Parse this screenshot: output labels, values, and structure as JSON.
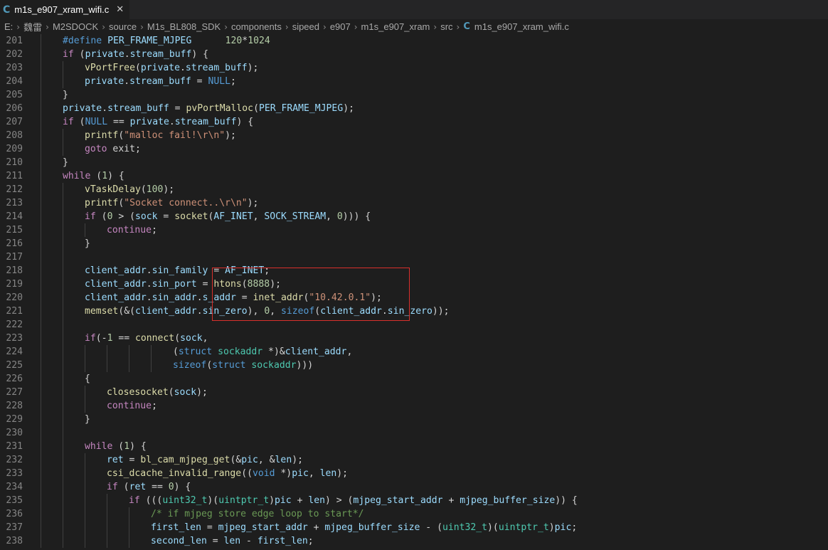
{
  "tab": {
    "icon": "C",
    "label": "m1s_e907_xram_wifi.c",
    "close": "✕"
  },
  "breadcrumb": {
    "items": [
      "E:",
      "魏雷",
      "M2SDOCK",
      "source",
      "M1s_BL808_SDK",
      "components",
      "sipeed",
      "e907",
      "m1s_e907_xram",
      "src"
    ],
    "file_icon": "C",
    "file": "m1s_e907_xram_wifi.c"
  },
  "colors": {
    "background": "#1e1e1e",
    "highlight_box": "#d9302c",
    "keyword": "#569cd6",
    "control": "#c586c0",
    "function": "#dcdcaa",
    "string": "#ce9178",
    "number": "#b5cea8",
    "comment": "#6a9955"
  },
  "lines": [
    {
      "n": "201",
      "indent": 1,
      "tokens": [
        [
          "macro",
          "#define "
        ],
        [
          "var",
          "PER_FRAME_MJPEG"
        ],
        [
          "pl",
          "      "
        ],
        [
          "num",
          "120"
        ],
        [
          "pl",
          "*"
        ],
        [
          "num",
          "1024"
        ]
      ]
    },
    {
      "n": "202",
      "indent": 1,
      "tokens": [
        [
          "ctl",
          "if"
        ],
        [
          "pl",
          " ("
        ],
        [
          "var",
          "private"
        ],
        [
          "pl",
          "."
        ],
        [
          "var",
          "stream_buff"
        ],
        [
          "pl",
          ") {"
        ]
      ]
    },
    {
      "n": "203",
      "indent": 2,
      "tokens": [
        [
          "fn",
          "vPortFree"
        ],
        [
          "pl",
          "("
        ],
        [
          "var",
          "private"
        ],
        [
          "pl",
          "."
        ],
        [
          "var",
          "stream_buff"
        ],
        [
          "pl",
          ");"
        ]
      ]
    },
    {
      "n": "204",
      "indent": 2,
      "tokens": [
        [
          "var",
          "private"
        ],
        [
          "pl",
          "."
        ],
        [
          "var",
          "stream_buff"
        ],
        [
          "pl",
          " = "
        ],
        [
          "kw",
          "NULL"
        ],
        [
          "pl",
          ";"
        ]
      ]
    },
    {
      "n": "205",
      "indent": 1,
      "tokens": [
        [
          "pl",
          "}"
        ]
      ]
    },
    {
      "n": "206",
      "indent": 1,
      "tokens": [
        [
          "var",
          "private"
        ],
        [
          "pl",
          "."
        ],
        [
          "var",
          "stream_buff"
        ],
        [
          "pl",
          " = "
        ],
        [
          "fn",
          "pvPortMalloc"
        ],
        [
          "pl",
          "("
        ],
        [
          "var",
          "PER_FRAME_MJPEG"
        ],
        [
          "pl",
          ");"
        ]
      ]
    },
    {
      "n": "207",
      "indent": 1,
      "tokens": [
        [
          "ctl",
          "if"
        ],
        [
          "pl",
          " ("
        ],
        [
          "kw",
          "NULL"
        ],
        [
          "pl",
          " == "
        ],
        [
          "var",
          "private"
        ],
        [
          "pl",
          "."
        ],
        [
          "var",
          "stream_buff"
        ],
        [
          "pl",
          ") {"
        ]
      ]
    },
    {
      "n": "208",
      "indent": 2,
      "tokens": [
        [
          "fn",
          "printf"
        ],
        [
          "pl",
          "("
        ],
        [
          "str",
          "\"malloc fail!\\r\\n\""
        ],
        [
          "pl",
          ");"
        ]
      ]
    },
    {
      "n": "209",
      "indent": 2,
      "tokens": [
        [
          "ctl",
          "goto"
        ],
        [
          "pl",
          " exit;"
        ]
      ]
    },
    {
      "n": "210",
      "indent": 1,
      "tokens": [
        [
          "pl",
          "}"
        ]
      ]
    },
    {
      "n": "211",
      "indent": 1,
      "tokens": [
        [
          "ctl",
          "while"
        ],
        [
          "pl",
          " ("
        ],
        [
          "num",
          "1"
        ],
        [
          "pl",
          ") {"
        ]
      ]
    },
    {
      "n": "212",
      "indent": 2,
      "tokens": [
        [
          "fn",
          "vTaskDelay"
        ],
        [
          "pl",
          "("
        ],
        [
          "num",
          "100"
        ],
        [
          "pl",
          ");"
        ]
      ]
    },
    {
      "n": "213",
      "indent": 2,
      "tokens": [
        [
          "fn",
          "printf"
        ],
        [
          "pl",
          "("
        ],
        [
          "str",
          "\"Socket connect..\\r\\n\""
        ],
        [
          "pl",
          ");"
        ]
      ]
    },
    {
      "n": "214",
      "indent": 2,
      "tokens": [
        [
          "ctl",
          "if"
        ],
        [
          "pl",
          " ("
        ],
        [
          "num",
          "0"
        ],
        [
          "pl",
          " > ("
        ],
        [
          "var",
          "sock"
        ],
        [
          "pl",
          " = "
        ],
        [
          "fn",
          "socket"
        ],
        [
          "pl",
          "("
        ],
        [
          "var",
          "AF_INET"
        ],
        [
          "pl",
          ", "
        ],
        [
          "var",
          "SOCK_STREAM"
        ],
        [
          "pl",
          ", "
        ],
        [
          "num",
          "0"
        ],
        [
          "pl",
          "))) {"
        ]
      ]
    },
    {
      "n": "215",
      "indent": 3,
      "tokens": [
        [
          "ctl",
          "continue"
        ],
        [
          "pl",
          ";"
        ]
      ]
    },
    {
      "n": "216",
      "indent": 2,
      "tokens": [
        [
          "pl",
          "}"
        ]
      ]
    },
    {
      "n": "217",
      "indent": 2,
      "tokens": []
    },
    {
      "n": "218",
      "indent": 2,
      "tokens": [
        [
          "var",
          "client_addr"
        ],
        [
          "pl",
          "."
        ],
        [
          "var",
          "sin_family"
        ],
        [
          "pl",
          " = "
        ],
        [
          "var",
          "AF_INET"
        ],
        [
          "pl",
          ";"
        ]
      ]
    },
    {
      "n": "219",
      "indent": 2,
      "tokens": [
        [
          "var",
          "client_addr"
        ],
        [
          "pl",
          "."
        ],
        [
          "var",
          "sin_port"
        ],
        [
          "pl",
          " = "
        ],
        [
          "fn",
          "htons"
        ],
        [
          "pl",
          "("
        ],
        [
          "num",
          "8888"
        ],
        [
          "pl",
          ");"
        ]
      ]
    },
    {
      "n": "220",
      "indent": 2,
      "tokens": [
        [
          "var",
          "client_addr"
        ],
        [
          "pl",
          "."
        ],
        [
          "var",
          "sin_addr"
        ],
        [
          "pl",
          "."
        ],
        [
          "var",
          "s_addr"
        ],
        [
          "pl",
          " = "
        ],
        [
          "fn",
          "inet_addr"
        ],
        [
          "pl",
          "("
        ],
        [
          "str",
          "\"10.42.0.1\""
        ],
        [
          "pl",
          ");"
        ]
      ]
    },
    {
      "n": "221",
      "indent": 2,
      "tokens": [
        [
          "fn",
          "memset"
        ],
        [
          "pl",
          "(&("
        ],
        [
          "var",
          "client_addr"
        ],
        [
          "pl",
          "."
        ],
        [
          "var",
          "sin_zero"
        ],
        [
          "pl",
          "), "
        ],
        [
          "num",
          "0"
        ],
        [
          "pl",
          ", "
        ],
        [
          "kw",
          "sizeof"
        ],
        [
          "pl",
          "("
        ],
        [
          "var",
          "client_addr"
        ],
        [
          "pl",
          "."
        ],
        [
          "var",
          "sin_zero"
        ],
        [
          "pl",
          "));"
        ]
      ]
    },
    {
      "n": "222",
      "indent": 2,
      "tokens": []
    },
    {
      "n": "223",
      "indent": 2,
      "tokens": [
        [
          "ctl",
          "if"
        ],
        [
          "pl",
          "(-"
        ],
        [
          "num",
          "1"
        ],
        [
          "pl",
          " == "
        ],
        [
          "fn",
          "connect"
        ],
        [
          "pl",
          "("
        ],
        [
          "var",
          "sock"
        ],
        [
          "pl",
          ","
        ]
      ]
    },
    {
      "n": "224",
      "indent": 6,
      "tokens": [
        [
          "pl",
          "("
        ],
        [
          "kw",
          "struct"
        ],
        [
          "pl",
          " "
        ],
        [
          "type",
          "sockaddr"
        ],
        [
          "pl",
          " *)&"
        ],
        [
          "var",
          "client_addr"
        ],
        [
          "pl",
          ","
        ]
      ]
    },
    {
      "n": "225",
      "indent": 6,
      "tokens": [
        [
          "kw",
          "sizeof"
        ],
        [
          "pl",
          "("
        ],
        [
          "kw",
          "struct"
        ],
        [
          "pl",
          " "
        ],
        [
          "type",
          "sockaddr"
        ],
        [
          "pl",
          ")))"
        ]
      ]
    },
    {
      "n": "226",
      "indent": 2,
      "tokens": [
        [
          "pl",
          "{"
        ]
      ]
    },
    {
      "n": "227",
      "indent": 3,
      "tokens": [
        [
          "fn",
          "closesocket"
        ],
        [
          "pl",
          "("
        ],
        [
          "var",
          "sock"
        ],
        [
          "pl",
          ");"
        ]
      ]
    },
    {
      "n": "228",
      "indent": 3,
      "tokens": [
        [
          "ctl",
          "continue"
        ],
        [
          "pl",
          ";"
        ]
      ]
    },
    {
      "n": "229",
      "indent": 2,
      "tokens": [
        [
          "pl",
          "}"
        ]
      ]
    },
    {
      "n": "230",
      "indent": 2,
      "tokens": []
    },
    {
      "n": "231",
      "indent": 2,
      "tokens": [
        [
          "ctl",
          "while"
        ],
        [
          "pl",
          " ("
        ],
        [
          "num",
          "1"
        ],
        [
          "pl",
          ") {"
        ]
      ]
    },
    {
      "n": "232",
      "indent": 3,
      "tokens": [
        [
          "var",
          "ret"
        ],
        [
          "pl",
          " = "
        ],
        [
          "fn",
          "bl_cam_mjpeg_get"
        ],
        [
          "pl",
          "(&"
        ],
        [
          "var",
          "pic"
        ],
        [
          "pl",
          ", &"
        ],
        [
          "var",
          "len"
        ],
        [
          "pl",
          ");"
        ]
      ]
    },
    {
      "n": "233",
      "indent": 3,
      "tokens": [
        [
          "fn",
          "csi_dcache_invalid_range"
        ],
        [
          "pl",
          "(("
        ],
        [
          "kw",
          "void"
        ],
        [
          "pl",
          " *)"
        ],
        [
          "var",
          "pic"
        ],
        [
          "pl",
          ", "
        ],
        [
          "var",
          "len"
        ],
        [
          "pl",
          ");"
        ]
      ]
    },
    {
      "n": "234",
      "indent": 3,
      "tokens": [
        [
          "ctl",
          "if"
        ],
        [
          "pl",
          " ("
        ],
        [
          "var",
          "ret"
        ],
        [
          "pl",
          " == "
        ],
        [
          "num",
          "0"
        ],
        [
          "pl",
          ") {"
        ]
      ]
    },
    {
      "n": "235",
      "indent": 4,
      "tokens": [
        [
          "ctl",
          "if"
        ],
        [
          "pl",
          " ((("
        ],
        [
          "type",
          "uint32_t"
        ],
        [
          "pl",
          ")("
        ],
        [
          "type",
          "uintptr_t"
        ],
        [
          "pl",
          ")"
        ],
        [
          "var",
          "pic"
        ],
        [
          "pl",
          " + "
        ],
        [
          "var",
          "len"
        ],
        [
          "pl",
          ") > ("
        ],
        [
          "var",
          "mjpeg_start_addr"
        ],
        [
          "pl",
          " + "
        ],
        [
          "var",
          "mjpeg_buffer_size"
        ],
        [
          "pl",
          ")) {"
        ]
      ]
    },
    {
      "n": "236",
      "indent": 5,
      "tokens": [
        [
          "cm",
          "/* if mjpeg store edge loop to start*/"
        ]
      ]
    },
    {
      "n": "237",
      "indent": 5,
      "tokens": [
        [
          "var",
          "first_len"
        ],
        [
          "pl",
          " = "
        ],
        [
          "var",
          "mjpeg_start_addr"
        ],
        [
          "pl",
          " + "
        ],
        [
          "var",
          "mjpeg_buffer_size"
        ],
        [
          "pl",
          " - ("
        ],
        [
          "type",
          "uint32_t"
        ],
        [
          "pl",
          ")("
        ],
        [
          "type",
          "uintptr_t"
        ],
        [
          "pl",
          ")"
        ],
        [
          "var",
          "pic"
        ],
        [
          "pl",
          ";"
        ]
      ]
    },
    {
      "n": "238",
      "indent": 5,
      "tokens": [
        [
          "var",
          "second_len"
        ],
        [
          "pl",
          " = "
        ],
        [
          "var",
          "len"
        ],
        [
          "pl",
          " - "
        ],
        [
          "var",
          "first_len"
        ],
        [
          "pl",
          ";"
        ]
      ]
    }
  ]
}
